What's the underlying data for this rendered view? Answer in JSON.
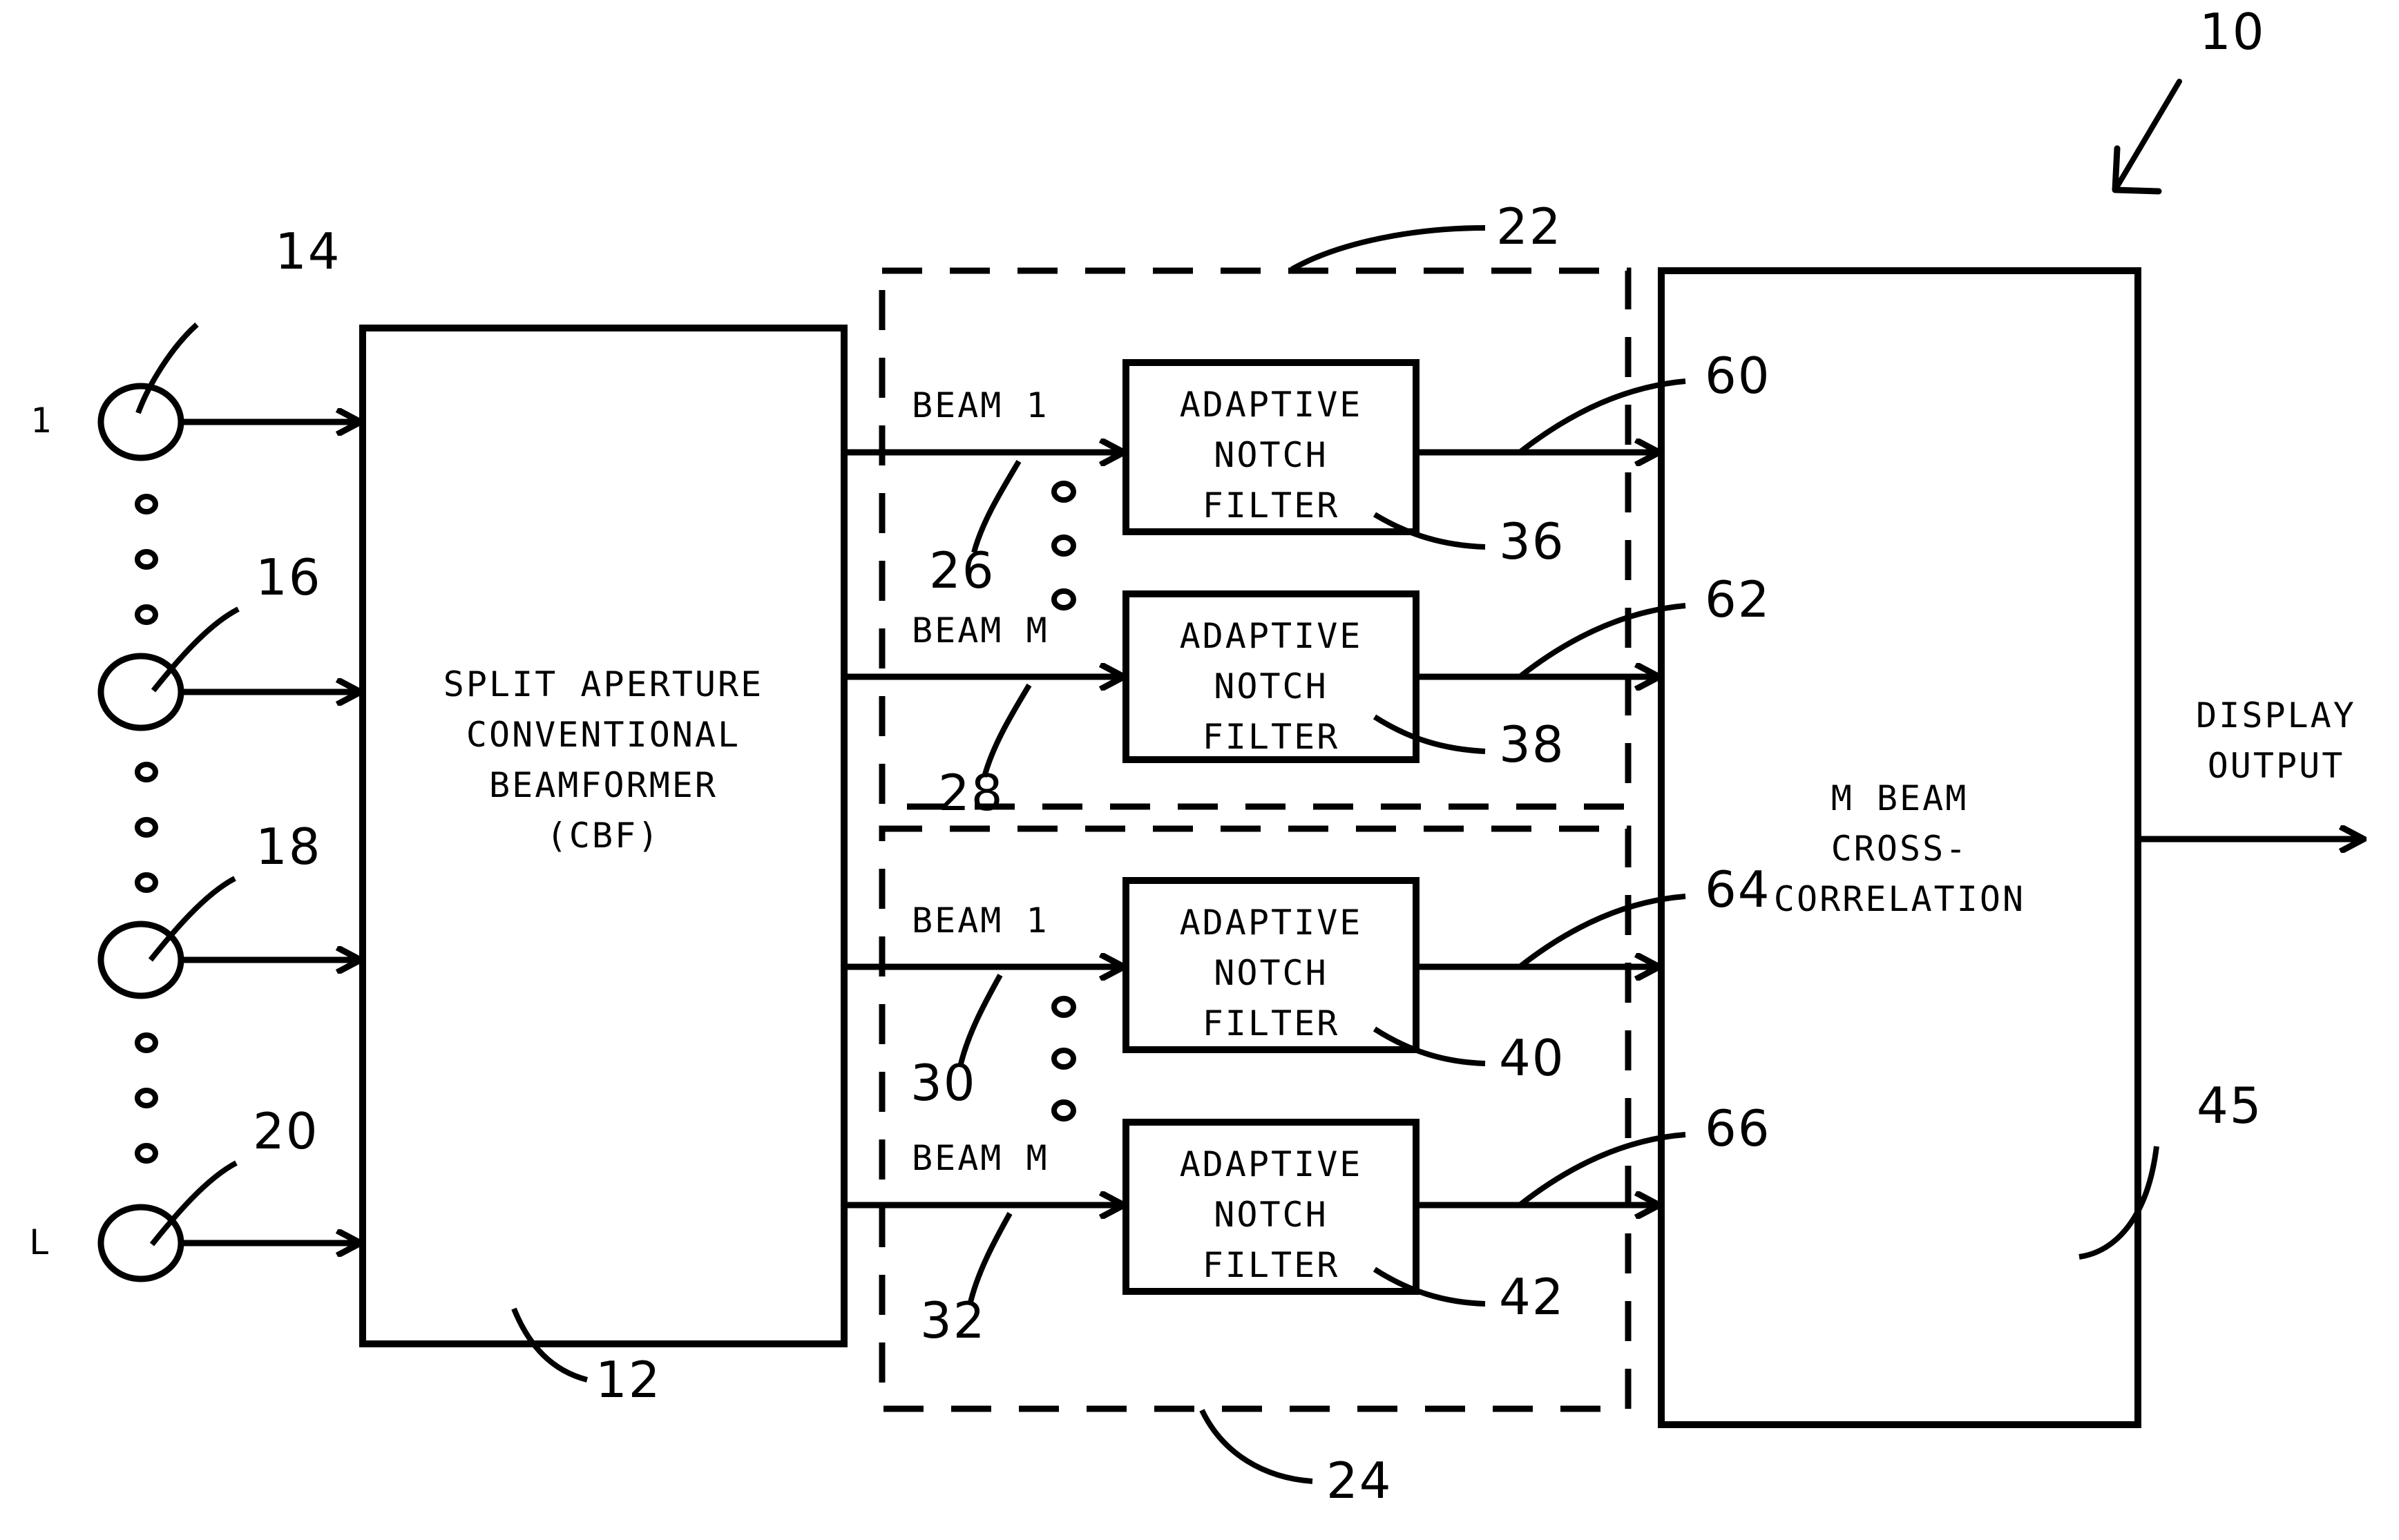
{
  "figure": {
    "reference_numeral": "10",
    "array": {
      "first_sensor_label": "1",
      "last_sensor_label": "L",
      "sensor_refs": [
        "14",
        "16",
        "18",
        "20"
      ]
    },
    "beamformer": {
      "ref": "12",
      "title_line1": "SPLIT APERTURE",
      "title_line2": "CONVENTIONAL",
      "title_line3": "BEAMFORMER",
      "title_line4": "(CBF)"
    },
    "upper_group": {
      "ref": "22",
      "rows": [
        {
          "beam_label": "BEAM 1",
          "beam_ref": "26",
          "filter_line1": "ADAPTIVE",
          "filter_line2": "NOTCH",
          "filter_line3": "FILTER",
          "filter_ref": "36",
          "output_ref": "60"
        },
        {
          "beam_label": "BEAM M",
          "beam_ref": "28",
          "filter_line1": "ADAPTIVE",
          "filter_line2": "NOTCH",
          "filter_line3": "FILTER",
          "filter_ref": "38",
          "output_ref": "62"
        }
      ]
    },
    "lower_group": {
      "ref": "24",
      "rows": [
        {
          "beam_label": "BEAM 1",
          "beam_ref": "30",
          "filter_line1": "ADAPTIVE",
          "filter_line2": "NOTCH",
          "filter_line3": "FILTER",
          "filter_ref": "40",
          "output_ref": "64"
        },
        {
          "beam_label": "BEAM M",
          "beam_ref": "32",
          "filter_line1": "ADAPTIVE",
          "filter_line2": "NOTCH",
          "filter_line3": "FILTER",
          "filter_ref": "42",
          "output_ref": "66"
        }
      ]
    },
    "correlator": {
      "ref": "45",
      "title_line1": "M BEAM",
      "title_line2": "CROSS-",
      "title_line3": "CORRELATION"
    },
    "output": {
      "line1": "DISPLAY",
      "line2": "OUTPUT"
    }
  },
  "colors": {
    "ink": "#000000",
    "paper": "#ffffff"
  }
}
